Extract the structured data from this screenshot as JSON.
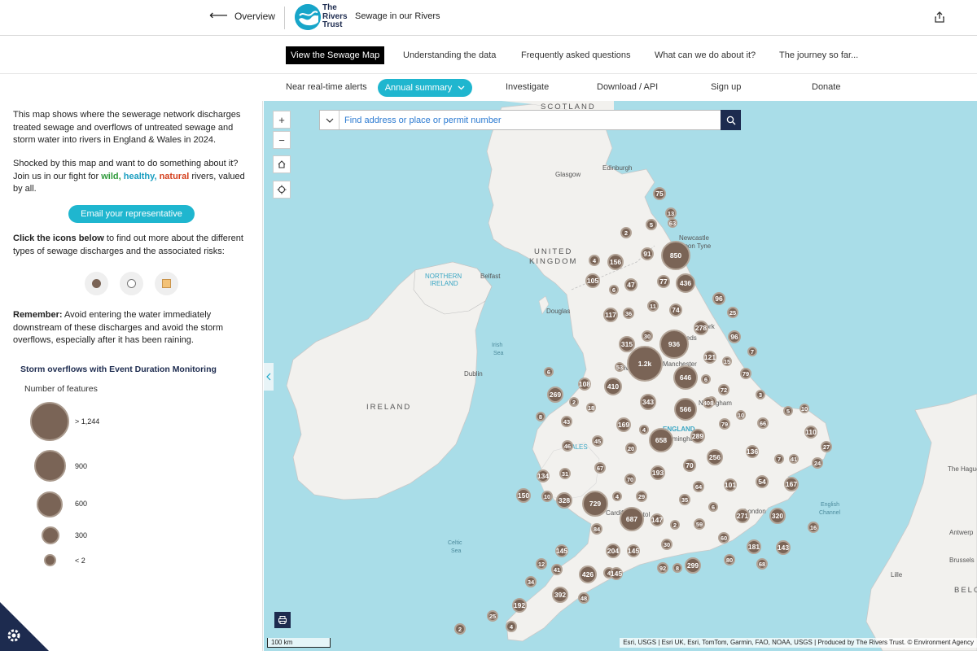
{
  "header": {
    "back_label": "Overview",
    "logo_text_1": "The",
    "logo_text_2": "Rivers",
    "logo_text_3": "Trust",
    "app_title": "Sewage in our Rivers"
  },
  "main_nav": {
    "items": [
      "View the Sewage Map",
      "Understanding the data",
      "Frequently asked questions",
      "What can we do about it?",
      "The journey so far..."
    ]
  },
  "sub_nav": {
    "near_realtime": "Near real-time alerts",
    "annual_summary": "Annual summary",
    "investigate": "Investigate",
    "download": "Download / API",
    "signup": "Sign up",
    "donate": "Donate"
  },
  "panel": {
    "intro": "This map shows where the sewerage network discharges treated sewage and overflows of untreated sewage and storm water into rivers in England & Wales in 2024.",
    "cta_1": "Shocked by this map and want to do something about it? Join us in our fight for ",
    "wild": "wild,",
    "healthy": "healthy,",
    "natural": "natural",
    "cta_2": " rivers, valued by all.",
    "email_button": "Email your representative",
    "click_bold": "Click the icons below",
    "click_rest": " to find out more about the different types of sewage discharges and the associated risks:",
    "remember_bold": "Remember:",
    "remember_rest": " Avoid entering the water immediately downstream of these discharges and avoid the storm overflows, especially after it has been raining.",
    "legend_title": "Storm overflows with Event Duration Monitoring",
    "legend_sub": "Number of features",
    "legend_items": [
      "> 1,244",
      "900",
      "600",
      "300",
      "< 2"
    ]
  },
  "map": {
    "search_placeholder": "Find address or place or permit number",
    "scale_label": "100 km",
    "attribution": "Esri, USGS | Esri UK, Esri, TomTom, Garmin, FAO, NOAA, USGS | Produced by The Rivers Trust. © Environment Agency",
    "labels": {
      "scotland": "SCOTLAND",
      "united": "UNITED",
      "kingdom": "KINGDOM",
      "ireland": "IRELAND",
      "northern": "NORTHERN",
      "ireland_small": "IRELAND",
      "england": "ENGLAND",
      "wales": "WALES",
      "glasgow": "Glasgow",
      "edinburgh": "Edinburgh",
      "newcastle": "Newcastle",
      "upon_tyne": "upon Tyne",
      "belfast": "Belfast",
      "douglas": "Douglas",
      "dublin": "Dublin",
      "york": "York",
      "leeds": "Leeds",
      "manchester": "Manchester",
      "liverpool": "Liverpool",
      "nottingham": "Nottingham",
      "birmingham": "Birmingham",
      "cardiff": "Cardiff",
      "bristol": "Bristol",
      "london": "London",
      "irish_sea": "Irish",
      "irish_sea_2": "Sea",
      "celtic_sea": "Celtic",
      "celtic_sea_2": "Sea",
      "english_channel": "English",
      "english_channel_2": "Channel",
      "the_hague": "The Hague",
      "antwerp": "Antwerp",
      "brussels": "Brussels",
      "lille": "Lille",
      "belg": "BELG"
    },
    "clusters": [
      "75",
      "13",
      "63",
      "5",
      "2",
      "850",
      "91",
      "4",
      "156",
      "105",
      "6",
      "47",
      "77",
      "436",
      "96",
      "25",
      "117",
      "36",
      "11",
      "74",
      "278",
      "30",
      "936",
      "315",
      "96",
      "7",
      "1.2k",
      "53",
      "646",
      "121",
      "15",
      "79",
      "6",
      "6",
      "72",
      "2",
      "408",
      "3",
      "108",
      "410",
      "269",
      "2",
      "18",
      "343",
      "566",
      "4",
      "10",
      "5",
      "10",
      "8",
      "43",
      "169",
      "4",
      "658",
      "289",
      "79",
      "66",
      "110",
      "45",
      "20",
      "46",
      "27",
      "134",
      "31",
      "67",
      "70",
      "193",
      "70",
      "256",
      "136",
      "7",
      "41",
      "24",
      "150",
      "10",
      "328",
      "729",
      "4",
      "29",
      "35",
      "64",
      "101",
      "54",
      "167",
      "687",
      "147",
      "2",
      "59",
      "6",
      "271",
      "320",
      "16",
      "84",
      "60",
      "30",
      "145",
      "204",
      "145",
      "181",
      "143",
      "12",
      "41",
      "426",
      "4",
      "145",
      "92",
      "8",
      "299",
      "80",
      "68",
      "34",
      "392",
      "48",
      "192",
      "25",
      "4",
      "2"
    ]
  }
}
